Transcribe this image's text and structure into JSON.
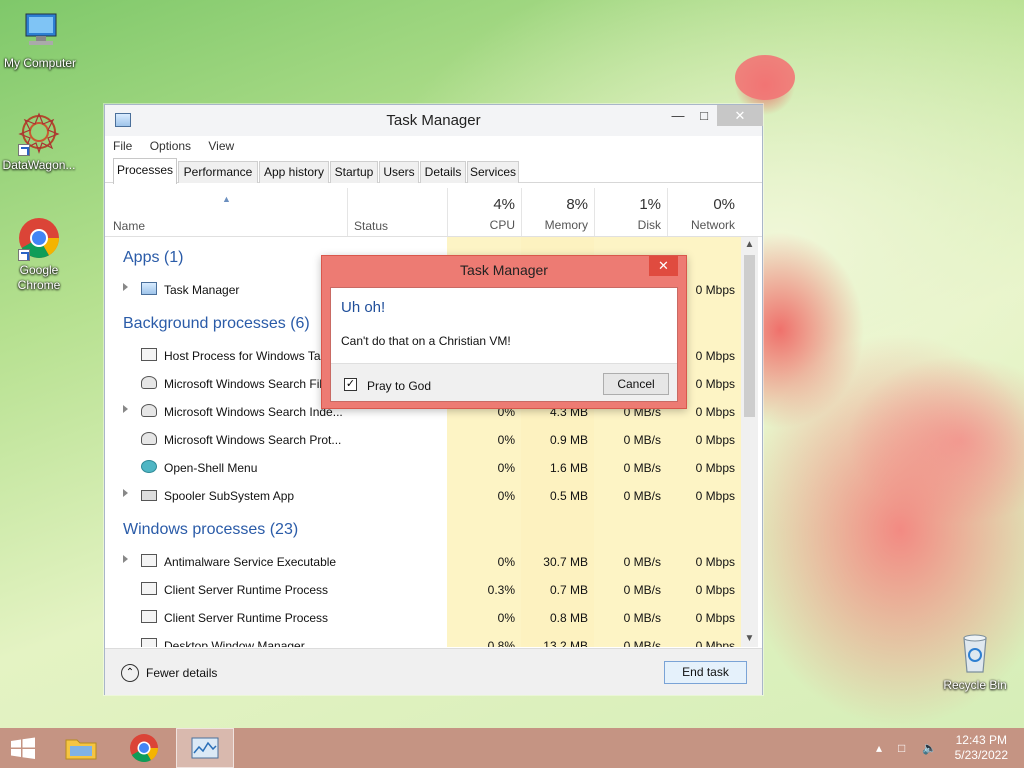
{
  "desktop": {
    "icons": [
      {
        "label": "My Computer"
      },
      {
        "label": "DataWagon..."
      },
      {
        "label": "Google Chrome"
      },
      {
        "label": "Recycle Bin"
      }
    ]
  },
  "task_manager": {
    "title": "Task Manager",
    "menu": [
      "File",
      "Options",
      "View"
    ],
    "tabs": [
      "Processes",
      "Performance",
      "App history",
      "Startup",
      "Users",
      "Details",
      "Services"
    ],
    "active_tab": "Processes",
    "columns": {
      "name": "Name",
      "status": "Status",
      "cpu": {
        "pct": "4%",
        "label": "CPU"
      },
      "memory": {
        "pct": "8%",
        "label": "Memory"
      },
      "disk": {
        "pct": "1%",
        "label": "Disk"
      },
      "network": {
        "pct": "0%",
        "label": "Network"
      }
    },
    "groups": {
      "apps": "Apps (1)",
      "background": "Background processes (6)",
      "windows": "Windows processes (23)"
    },
    "rows": [
      {
        "name": "Task Manager",
        "cpu": "",
        "mem": "",
        "disk": "",
        "net": "0 Mbps"
      },
      {
        "name": "Host Process for Windows Tasks",
        "cpu": "",
        "mem": "",
        "disk": "",
        "net": "0 Mbps"
      },
      {
        "name": "Microsoft Windows Search Filter Host",
        "cpu": "",
        "mem": "",
        "disk": "",
        "net": "0 Mbps"
      },
      {
        "name": "Microsoft Windows Search Inde...",
        "cpu": "0%",
        "mem": "4.3 MB",
        "disk": "0 MB/s",
        "net": "0 Mbps"
      },
      {
        "name": "Microsoft Windows Search Prot...",
        "cpu": "0%",
        "mem": "0.9 MB",
        "disk": "0 MB/s",
        "net": "0 Mbps"
      },
      {
        "name": "Open-Shell Menu",
        "cpu": "0%",
        "mem": "1.6 MB",
        "disk": "0 MB/s",
        "net": "0 Mbps"
      },
      {
        "name": "Spooler SubSystem App",
        "cpu": "0%",
        "mem": "0.5 MB",
        "disk": "0 MB/s",
        "net": "0 Mbps"
      },
      {
        "name": "Antimalware Service Executable",
        "cpu": "0%",
        "mem": "30.7 MB",
        "disk": "0 MB/s",
        "net": "0 Mbps"
      },
      {
        "name": "Client Server Runtime Process",
        "cpu": "0.3%",
        "mem": "0.7 MB",
        "disk": "0 MB/s",
        "net": "0 Mbps"
      },
      {
        "name": "Client Server Runtime Process",
        "cpu": "0%",
        "mem": "0.8 MB",
        "disk": "0 MB/s",
        "net": "0 Mbps"
      },
      {
        "name": "Desktop Window Manager",
        "cpu": "0.8%",
        "mem": "13.2 MB",
        "disk": "0 MB/s",
        "net": "0 Mbps"
      }
    ],
    "footer": {
      "fewer_details": "Fewer details",
      "end_task": "End task"
    }
  },
  "dialog": {
    "title": "Task Manager",
    "main_instruction": "Uh oh!",
    "message": "Can't do that on a Christian VM!",
    "checkbox_label": "Pray to God",
    "checkbox_checked": true,
    "cancel": "Cancel"
  },
  "taskbar": {
    "time": "12:43 PM",
    "date": "5/23/2022"
  }
}
